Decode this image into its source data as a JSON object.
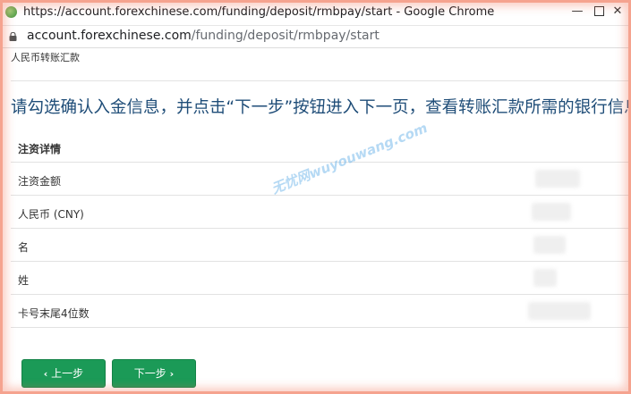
{
  "window": {
    "title": "https://account.forexchinese.com/funding/deposit/rmbpay/start - Google Chrome",
    "minimize": "—",
    "close": "✕"
  },
  "address": {
    "host": "account.forexchinese.com",
    "path": "/funding/deposit/rmbpay/start"
  },
  "page": {
    "breadcrumb": "人民币转账汇款",
    "instruction": "请勾选确认入金信息，并点击“下一步”按钮进入下一页，查看转账汇款所需的银行信息。",
    "table": {
      "header": "注资详情",
      "rows": [
        {
          "label": "注资金额"
        },
        {
          "label": "人民币 (CNY)"
        },
        {
          "label": "名"
        },
        {
          "label": "姓"
        },
        {
          "label": "卡号末尾4位数"
        }
      ]
    },
    "watermark": "无忧网wuyouwang.com",
    "buttons": {
      "prev_label": "上一步",
      "next_label": "下一步",
      "prev_icon": "‹",
      "next_icon": "›"
    }
  },
  "colors": {
    "accent_green": "#1b9a57",
    "instruction_blue": "#1f4d78",
    "frame_orange": "#f5a38f"
  }
}
